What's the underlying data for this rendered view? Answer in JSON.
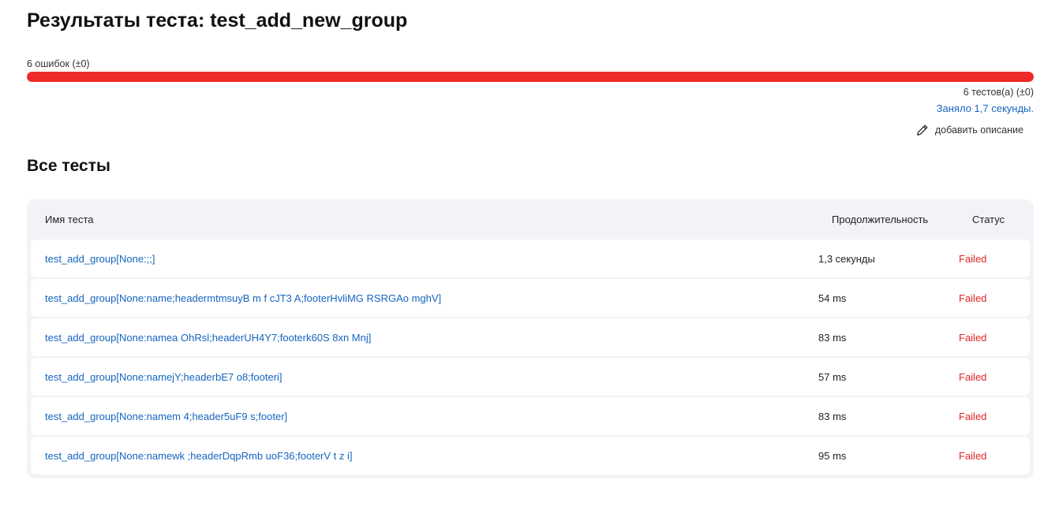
{
  "page": {
    "title": "Результаты теста: test_add_new_group"
  },
  "summary": {
    "fail_count": "6 ошибок (±0)",
    "fail_ratio": 1.0,
    "tests_count": "6 тестов(а) (±0)",
    "duration": "Заняло 1,7 секунды.",
    "add_description": "добавить описание",
    "edit_icon": "pencil-icon"
  },
  "colors": {
    "fail": "#ee2a2a",
    "link": "#1565c0",
    "status_failed": "#e02424"
  },
  "section": {
    "title": "Все тесты"
  },
  "table": {
    "headers": {
      "name": "Имя теста",
      "duration": "Продолжительность",
      "status": "Статус"
    },
    "rows": [
      {
        "name": "test_add_group[None:;;]",
        "duration": "1,3 секунды",
        "status": "Failed"
      },
      {
        "name": "test_add_group[None:name;headermtmsuyB m f cJT3 A;footerHvliMG RSRGAo mghV]",
        "duration": "54 ms",
        "status": "Failed"
      },
      {
        "name": "test_add_group[None:namea OhRsl;headerUH4Y7;footerk60S 8xn Mnj]",
        "duration": "83 ms",
        "status": "Failed"
      },
      {
        "name": "test_add_group[None:namejY;headerbE7 o8;footeri]",
        "duration": "57 ms",
        "status": "Failed"
      },
      {
        "name": "test_add_group[None:namem 4;header5uF9 s;footer]",
        "duration": "83 ms",
        "status": "Failed"
      },
      {
        "name": "test_add_group[None:namewk ;headerDqpRmb uoF36;footerV t z i]",
        "duration": "95 ms",
        "status": "Failed"
      }
    ]
  }
}
